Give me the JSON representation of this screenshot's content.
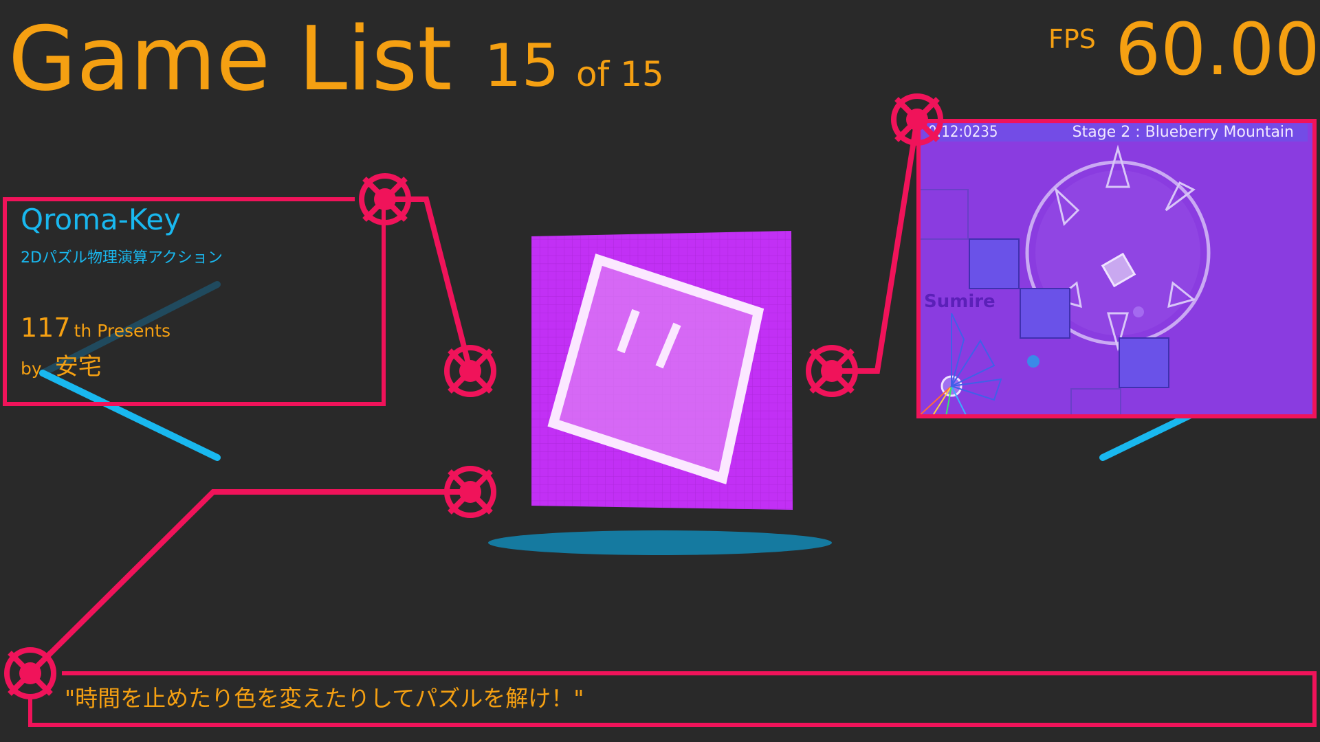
{
  "header": {
    "title": "Game List",
    "current_index": "15",
    "of_total": "of 15",
    "fps_label": "FPS",
    "fps_value": "60.00"
  },
  "game": {
    "title": "Qroma-Key",
    "genre": "2Dパズル物理演算アクション",
    "presents_number": "117",
    "presents_suffix": "th Presents",
    "by_label": "by",
    "author": "安宅",
    "description": "\"時間を止めたり色を変えたりしてパズルを解け！\""
  },
  "screenshot": {
    "timer": "0:12:0235",
    "stage": "Stage 2 : Blueberry Mountain",
    "label": "Sumire"
  },
  "colors": {
    "background": "#292929",
    "accent_orange": "#f5a012",
    "accent_cyan": "#19b8ef",
    "frame_pink": "#f0135a",
    "icon_purple": "#c230f5"
  },
  "icons": [
    "crosshair-icon",
    "game-icon-cube"
  ]
}
